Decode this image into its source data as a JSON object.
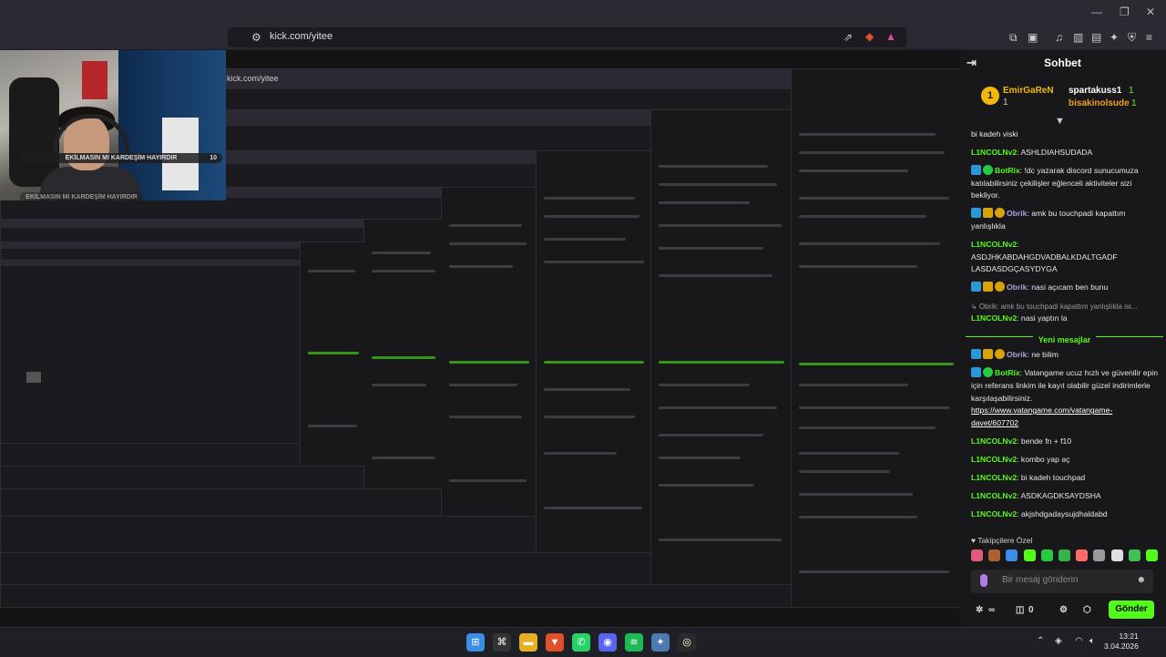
{
  "browser": {
    "url": "kick.com/yitee",
    "window_controls": [
      "—",
      "❐",
      "✕"
    ]
  },
  "stream_overlay": {
    "alerts": [
      {
        "text": "EKİLMASIN MI KARDEŞİM HAYIRDIR",
        "count": "10"
      },
      {
        "text": "EKİLMASIN MI KARDEŞİM HAYIRDIR",
        "count": ""
      }
    ],
    "nested_url": "kick.com/yitee"
  },
  "chat": {
    "title": "Sohbet",
    "pinned": {
      "rank": "1",
      "user1": "EmirGaReN",
      "user1_count": "1",
      "user2": "spartakuss1",
      "user2_count": "1",
      "user3": "bisakinolsude",
      "user3_count": "1"
    },
    "messages": [
      {
        "type": "text",
        "name": "",
        "text": "bi kadeh viski"
      },
      {
        "type": "msg",
        "name": "L1NCOLNv2",
        "name_color": "green",
        "badges": [],
        "text": "ASHLDIAHSUDADA"
      },
      {
        "type": "msg",
        "name": "BotRix",
        "name_color": "green",
        "badges": [
          "blue",
          "green"
        ],
        "text": "!dc yazarak discord sunucumuza katılabilirsiniz çekilişler eğlenceli aktiviteler sizi bekliyor."
      },
      {
        "type": "msg",
        "name": "Obrik",
        "name_color": "purple",
        "badges": [
          "blue",
          "gold",
          "coin"
        ],
        "text": "amk bu touchpadi kapattım yanlışlıkla"
      },
      {
        "type": "msg",
        "name": "L1NCOLNv2",
        "name_color": "green",
        "badges": [],
        "text": "ASDJHKABDAHGDVADBALKDALTGADF LASDASDGÇASYDYGA",
        "block": true
      },
      {
        "type": "msg",
        "name": "Obrik",
        "name_color": "purple",
        "badges": [
          "blue",
          "gold",
          "coin"
        ],
        "text": "nasi açıcam ben bunu"
      },
      {
        "type": "reply",
        "reply": "↳ Obrik: amk bu touchpadi kapattım yanlışlıkla isi...",
        "name": "L1NCOLNv2",
        "name_color": "green",
        "text": "nasi yaptın la"
      },
      {
        "type": "sep",
        "text": "Yeni mesajlar"
      },
      {
        "type": "msg",
        "name": "Obrik",
        "name_color": "purple",
        "badges": [
          "blue",
          "gold",
          "coin"
        ],
        "text": "ne bilim"
      },
      {
        "type": "msg",
        "name": "BotRix",
        "name_color": "green",
        "badges": [
          "blue",
          "green"
        ],
        "text": "Vatangame ucuz hızlı ve güvenilir epin için referans linkim ile kayıt olabilir güzel indirimlerle karşılaşabilirsiniz.",
        "link": "https://www.vatangame.com/vatangame-davet/607702"
      },
      {
        "type": "msg",
        "name": "L1NCOLNv2",
        "name_color": "green",
        "badges": [],
        "text": "bende fn + f10"
      },
      {
        "type": "msg",
        "name": "L1NCOLNv2",
        "name_color": "green",
        "badges": [],
        "text": "kombo yap aç"
      },
      {
        "type": "msg",
        "name": "L1NCOLNv2",
        "name_color": "green",
        "badges": [],
        "text": "bi kadeh touchpad"
      },
      {
        "type": "msg",
        "name": "L1NCOLNv2",
        "name_color": "green",
        "badges": [],
        "text": "ASDKAGDKSAYDSHA"
      },
      {
        "type": "msg",
        "name": "L1NCOLNv2",
        "name_color": "green",
        "badges": [],
        "text": "akjshdgadaysujdhaldabd"
      }
    ],
    "followers_label": "Takipçilere Özel",
    "emote_colors": [
      "#e05a7a",
      "#b06030",
      "#3a8ee6",
      "#53fc18",
      "#27c93f",
      "#37b24d",
      "#ff6b6b",
      "#9a9a9a",
      "#e0e0e0",
      "#40c057",
      "#53fc18"
    ],
    "input_placeholder": "Bir mesaj gönderin",
    "footer_count_1": "∞",
    "footer_count_2": "0",
    "send_label": "Gönder"
  },
  "taskbar": {
    "time": "13:21",
    "date": "3.04.2026",
    "apps": [
      {
        "name": "windows-start-icon",
        "color": "#3a8ee6",
        "glyph": "⊞"
      },
      {
        "name": "terminal-icon",
        "color": "#333",
        "glyph": "⌘"
      },
      {
        "name": "file-explorer-icon",
        "color": "#e8b020",
        "glyph": "▬"
      },
      {
        "name": "brave-icon",
        "color": "#e0512a",
        "glyph": "▼"
      },
      {
        "name": "whatsapp-icon",
        "color": "#25d366",
        "glyph": "✆"
      },
      {
        "name": "discord-icon",
        "color": "#5865f2",
        "glyph": "◉"
      },
      {
        "name": "spotify-icon",
        "color": "#1db954",
        "glyph": "≋"
      },
      {
        "name": "app-icon",
        "color": "#4a7ab0",
        "glyph": "✦"
      },
      {
        "name": "obs-icon",
        "color": "#2a2a2a",
        "glyph": "◎"
      }
    ]
  }
}
